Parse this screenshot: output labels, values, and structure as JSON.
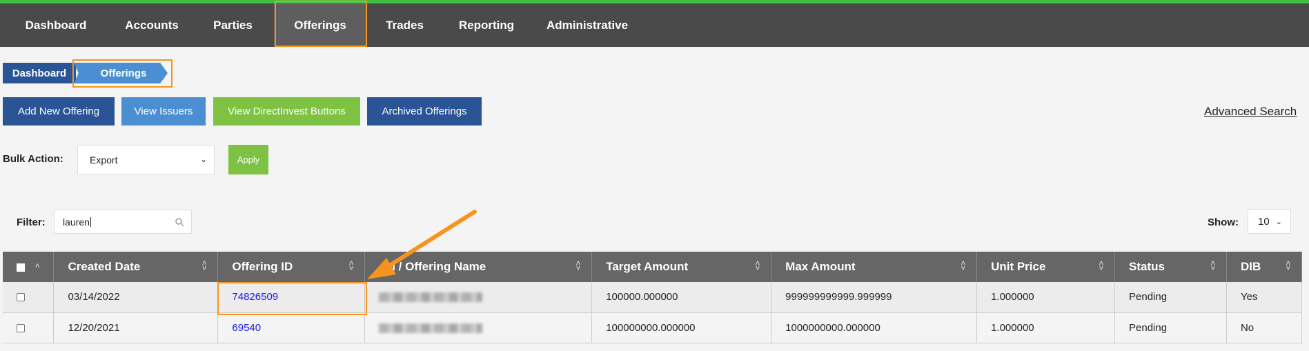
{
  "nav": {
    "items": [
      {
        "label": "Dashboard"
      },
      {
        "label": "Accounts"
      },
      {
        "label": "Parties"
      },
      {
        "label": "Offerings"
      },
      {
        "label": "Trades"
      },
      {
        "label": "Reporting"
      },
      {
        "label": "Administrative"
      }
    ],
    "active": "Offerings"
  },
  "breadcrumb": {
    "items": [
      {
        "label": "Dashboard"
      },
      {
        "label": "Offerings"
      }
    ]
  },
  "actions": {
    "add_new_offering": "Add New Offering",
    "view_issuers": "View Issuers",
    "view_directinvest": "View DirectInvest Buttons",
    "archived_offerings": "Archived Offerings",
    "advanced_search": "Advanced Search"
  },
  "bulk": {
    "label": "Bulk Action:",
    "selected": "Export",
    "apply_label": "Apply"
  },
  "filter": {
    "label": "Filter:",
    "value": "lauren"
  },
  "show": {
    "label": "Show:",
    "value": "10"
  },
  "table": {
    "headers": [
      "Created Date",
      "Offering ID",
      "eal / Offering Name",
      "Target Amount",
      "Max Amount",
      "Unit Price",
      "Status",
      "DIB"
    ],
    "rows": [
      {
        "created": "03/14/2022",
        "offering_id": "74826509",
        "target": "100000.000000",
        "max": "999999999999.999999",
        "unit_price": "1.000000",
        "status": "Pending",
        "dib": "Yes"
      },
      {
        "created": "12/20/2021",
        "offering_id": "69540",
        "target": "100000000.000000",
        "max": "1000000000.000000",
        "unit_price": "1.000000",
        "status": "Pending",
        "dib": "No"
      }
    ]
  },
  "colors": {
    "nav_bg": "#4a4a4a",
    "nav_top_border": "#3fbf3f",
    "primary_blue": "#2a5496",
    "light_blue": "#4b8fd2",
    "green": "#7dc242",
    "highlight_orange": "#f7941d",
    "link": "#1a1ae6"
  }
}
